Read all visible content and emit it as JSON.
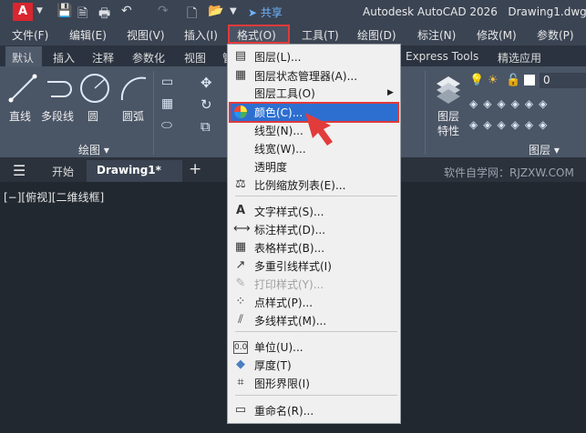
{
  "titlebar": {
    "logo": "A",
    "share": "共享",
    "app_title": "Autodesk AutoCAD 2026",
    "doc_title": "Drawing1.dwg"
  },
  "menubar": [
    "文件(F)",
    "编辑(E)",
    "视图(V)",
    "插入(I)",
    "格式(O)",
    "工具(T)",
    "绘图(D)",
    "标注(N)",
    "修改(M)",
    "参数(P)"
  ],
  "ribbon_tabs": [
    "默认",
    "插入",
    "注释",
    "参数化",
    "视图",
    "管",
    "Express Tools",
    "精选应用"
  ],
  "ribbon": {
    "draw_tools": [
      "直线",
      "多段线",
      "圆",
      "圆弧"
    ],
    "draw_panel": "绘图",
    "layer_props": [
      "图层",
      "特性"
    ],
    "layer_panel": "图层",
    "layer_value": "0"
  },
  "doc_tabs": {
    "start": "开始",
    "drawing": "Drawing1*",
    "watermark": "软件自学网：RJZXW.COM"
  },
  "viewport_label": "[−][俯视][二维线框]",
  "format_menu": {
    "items": [
      {
        "label": "图层(L)...",
        "icon": "layers-icon"
      },
      {
        "label": "图层状态管理器(A)...",
        "icon": "layer-state-icon"
      },
      {
        "label": "图层工具(O)",
        "icon": ""
      },
      {
        "label": "颜色(C)...",
        "icon": "color-wheel-icon"
      },
      {
        "label": "线型(N)...",
        "icon": ""
      },
      {
        "label": "线宽(W)...",
        "icon": ""
      },
      {
        "label": "透明度",
        "icon": ""
      },
      {
        "label": "比例缩放列表(E)...",
        "icon": "scale-list-icon"
      },
      {
        "label": "文字样式(S)...",
        "icon": "text-style-icon"
      },
      {
        "label": "标注样式(D)...",
        "icon": "dim-style-icon"
      },
      {
        "label": "表格样式(B)...",
        "icon": "table-style-icon"
      },
      {
        "label": "多重引线样式(I)",
        "icon": "mleader-style-icon"
      },
      {
        "label": "打印样式(Y)...",
        "icon": "plot-style-icon"
      },
      {
        "label": "点样式(P)...",
        "icon": "point-style-icon"
      },
      {
        "label": "多线样式(M)...",
        "icon": "mline-style-icon"
      },
      {
        "label": "单位(U)...",
        "icon": "units-icon"
      },
      {
        "label": "厚度(T)",
        "icon": "thickness-icon"
      },
      {
        "label": "图形界限(I)",
        "icon": "limits-icon"
      },
      {
        "label": "重命名(R)...",
        "icon": "rename-icon"
      }
    ]
  }
}
